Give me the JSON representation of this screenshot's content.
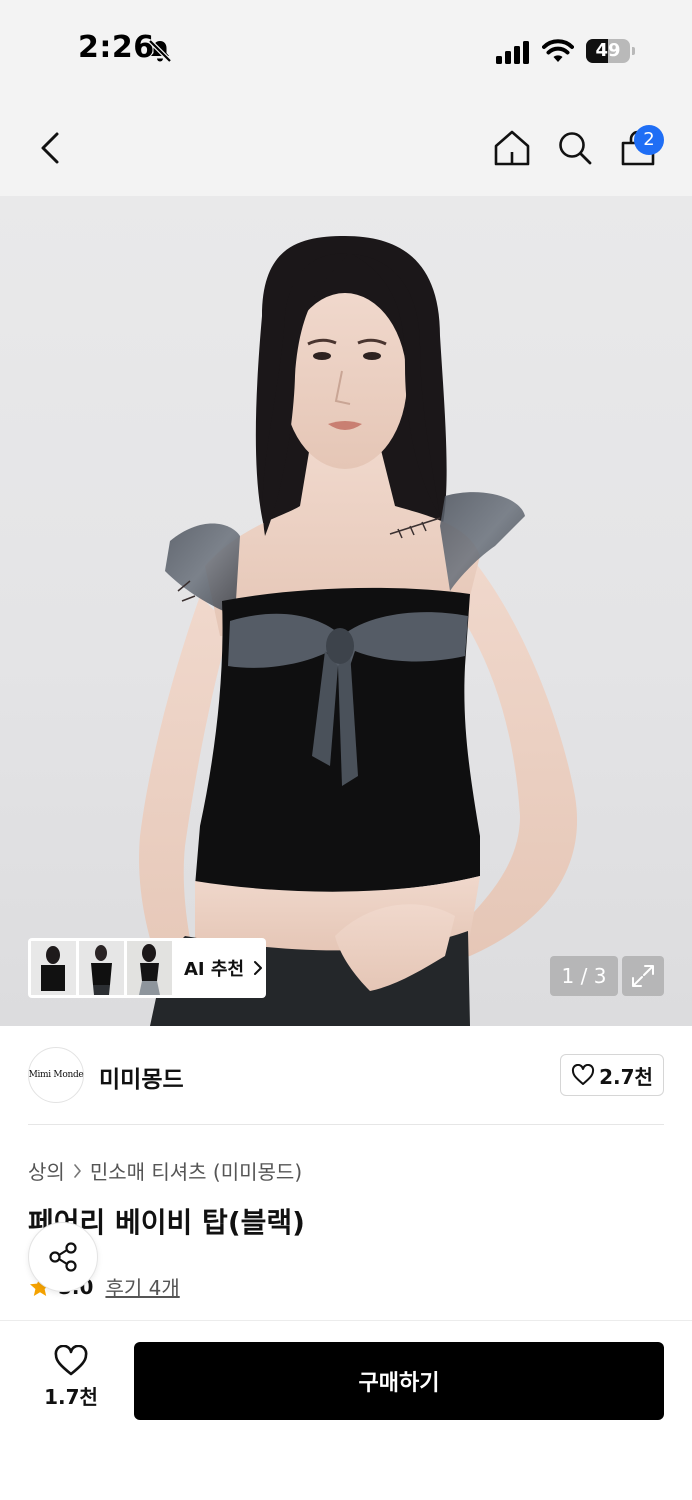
{
  "status_bar": {
    "time": "2:26",
    "battery_level": "49",
    "battery_fraction": 0.49
  },
  "nav": {
    "cart_count": "2"
  },
  "hero": {
    "page_indicator": "1 / 3"
  },
  "ai_recommend": {
    "label": "AI 추천"
  },
  "brand": {
    "logo_text": "Mimi Monde",
    "name": "미미몽드",
    "like_count": "2.7천"
  },
  "breadcrumb": {
    "category": "상의",
    "subcategory": "민소매 티셔츠 (미미몽드)"
  },
  "product": {
    "title": "페어리 베이비 탑(블랙)",
    "rating_value": "5.0",
    "review_link": "후기 4개"
  },
  "bottom": {
    "wish_count": "1.7천",
    "buy_label": "구매하기"
  },
  "colors": {
    "accent_badge": "#1f6ef5",
    "buy_button": "#000000",
    "star": "#f5a200"
  }
}
